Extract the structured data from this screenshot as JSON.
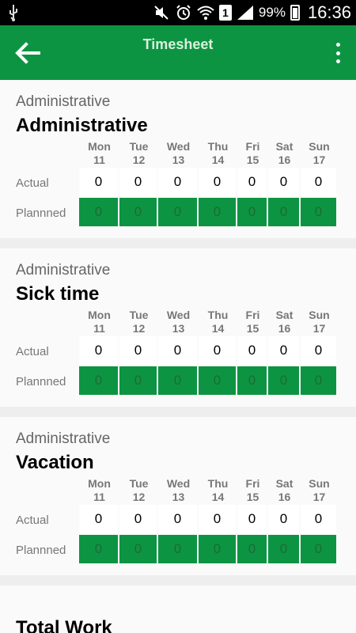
{
  "status_bar": {
    "usb_icon": "usb-icon",
    "sim_label": "1",
    "battery_pct": "99%",
    "time": "16:36"
  },
  "app_bar": {
    "title": "Timesheet"
  },
  "labels": {
    "actual": "Actual",
    "planned": "Plannned"
  },
  "days": [
    {
      "name": "Mon",
      "date": "11"
    },
    {
      "name": "Tue",
      "date": "12"
    },
    {
      "name": "Wed",
      "date": "13"
    },
    {
      "name": "Thu",
      "date": "14"
    },
    {
      "name": "Fri",
      "date": "15"
    },
    {
      "name": "Sat",
      "date": "16"
    },
    {
      "name": "Sun",
      "date": "17"
    }
  ],
  "cards": [
    {
      "category": "Administrative",
      "name": "Administrative",
      "actual": [
        "0",
        "0",
        "0",
        "0",
        "0",
        "0",
        "0"
      ],
      "planned": [
        "0",
        "0",
        "0",
        "0",
        "0",
        "0",
        "0"
      ]
    },
    {
      "category": "Administrative",
      "name": "Sick time",
      "actual": [
        "0",
        "0",
        "0",
        "0",
        "0",
        "0",
        "0"
      ],
      "planned": [
        "0",
        "0",
        "0",
        "0",
        "0",
        "0",
        "0"
      ]
    },
    {
      "category": "Administrative",
      "name": "Vacation",
      "actual": [
        "0",
        "0",
        "0",
        "0",
        "0",
        "0",
        "0"
      ],
      "planned": [
        "0",
        "0",
        "0",
        "0",
        "0",
        "0",
        "0"
      ]
    }
  ],
  "total_label": "Total Work",
  "colors": {
    "primary": "#0d9442",
    "status_bar": "#000000",
    "background": "#eeeeee"
  }
}
